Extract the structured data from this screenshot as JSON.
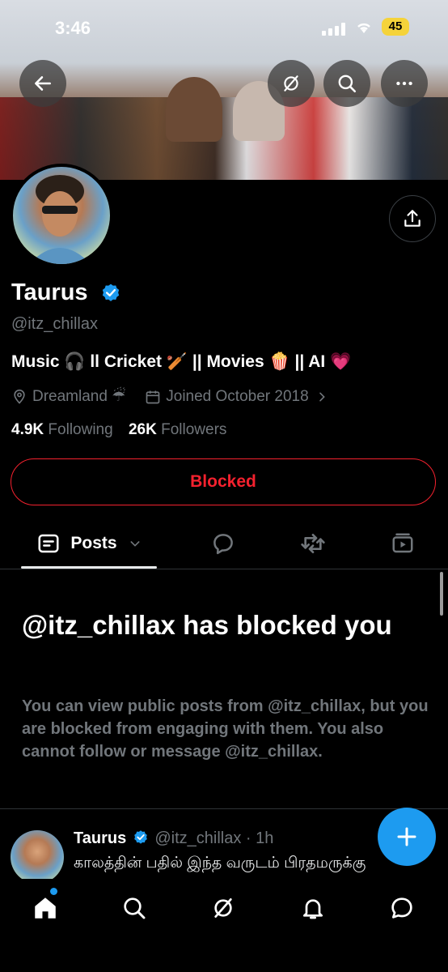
{
  "status_bar": {
    "time": "3:46",
    "battery": "45"
  },
  "profile": {
    "name": "Taurus",
    "handle": "@itz_chillax",
    "bio": "Music 🎧 ll Cricket 🏏 || Movies 🍿 || AI 💗",
    "location": "Dreamland ☔",
    "joined": "Joined October 2018",
    "following_count": "4.9K",
    "following_label": "Following",
    "followers_count": "26K",
    "followers_label": "Followers",
    "blocked_label": "Blocked"
  },
  "tabs": {
    "posts_label": "Posts"
  },
  "blocked_notice": {
    "title": "@itz_chillax has blocked you",
    "text": "You can view public posts from @itz_chillax, but you are blocked from engaging with them. You also cannot follow or message @itz_chillax."
  },
  "post": {
    "name": "Taurus",
    "meta": "@itz_chillax · 1h",
    "text": "காலத்தின் பதில் இந்த வருடம் பிரதமருக்கு"
  },
  "colors": {
    "accent": "#1d9bf0",
    "blocked": "#f4212e",
    "muted": "#71767b"
  }
}
